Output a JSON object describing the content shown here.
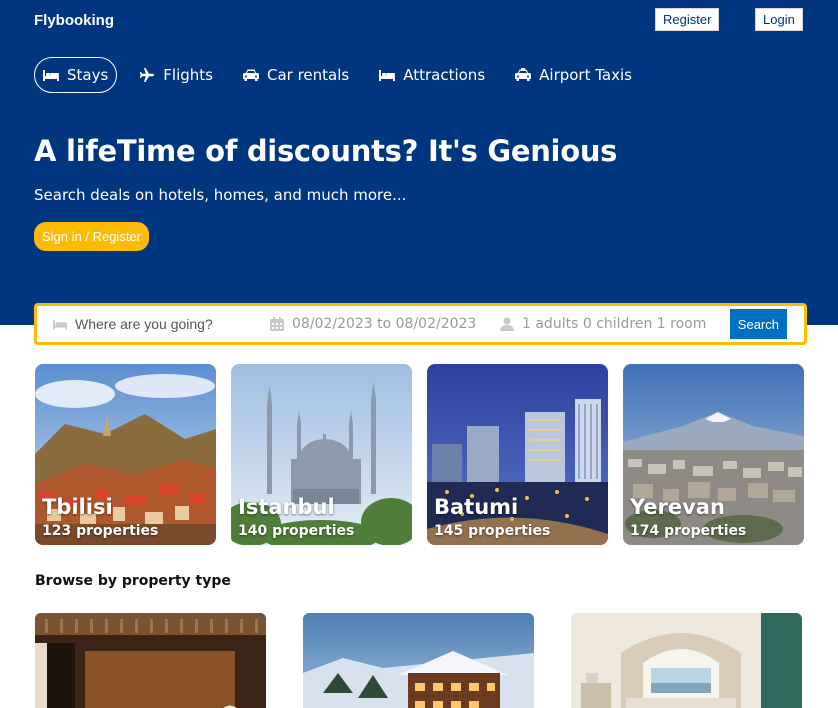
{
  "header": {
    "brand": "Flybooking",
    "register_label": "Register",
    "login_label": "Login"
  },
  "nav": [
    {
      "label": "Stays",
      "icon": "bed-icon",
      "active": true
    },
    {
      "label": "Flights",
      "icon": "plane-icon",
      "active": false
    },
    {
      "label": "Car rentals",
      "icon": "car-icon",
      "active": false
    },
    {
      "label": "Attractions",
      "icon": "bed-icon",
      "active": false
    },
    {
      "label": "Airport Taxis",
      "icon": "taxi-icon",
      "active": false
    }
  ],
  "hero": {
    "title": "A lifeTime of discounts? It's Genious",
    "subtitle": "Search deals on hotels, homes, and much more...",
    "signin_label": "Sign in / Register"
  },
  "search": {
    "destination_placeholder": "Where are you going?",
    "dates": "08/02/2023 to 08/02/2023",
    "options": "1 adults 0 children 1 room",
    "button_label": "Search"
  },
  "cities": [
    {
      "name": "Tbilisi",
      "count": "123 properties"
    },
    {
      "name": "Istanbul",
      "count": "140 properties"
    },
    {
      "name": "Batumi",
      "count": "145 properties"
    },
    {
      "name": "Yerevan",
      "count": "174 properties"
    }
  ],
  "browse": {
    "title": "Browse by property type"
  },
  "colors": {
    "brand": "#003580",
    "accent": "#febb02",
    "button": "#0071c2"
  }
}
